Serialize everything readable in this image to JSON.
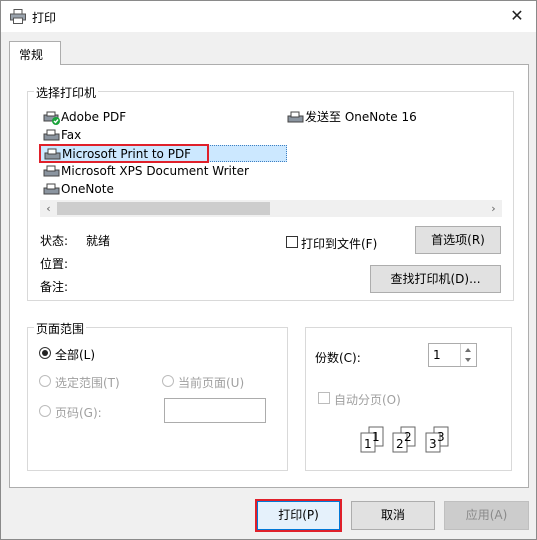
{
  "window": {
    "title": "打印",
    "close_glyph": "✕"
  },
  "tabs": [
    {
      "label": "常规"
    }
  ],
  "printer_group": {
    "label": "选择打印机",
    "printers": [
      {
        "name": "Adobe PDF",
        "icon": "printer-default-icon"
      },
      {
        "name": "Fax",
        "icon": "fax-icon"
      },
      {
        "name": "Microsoft Print to PDF",
        "icon": "printer-icon",
        "selected": true
      },
      {
        "name": "Microsoft XPS Document Writer",
        "icon": "printer-icon"
      },
      {
        "name": "OneNote",
        "icon": "printer-icon"
      },
      {
        "name": "发送至 OneNote 16",
        "icon": "printer-icon"
      }
    ],
    "scroll_left": "‹",
    "scroll_right": "›"
  },
  "status": {
    "status_label": "状态:",
    "status_value": "就绪",
    "location_label": "位置:",
    "comment_label": "备注:",
    "print_to_file": "打印到文件(F)",
    "preferences_button": "首选项(R)",
    "find_printer_button": "查找打印机(D)..."
  },
  "page_range": {
    "label": "页面范围",
    "all": "全部(L)",
    "selection": "选定范围(T)",
    "current_page": "当前页面(U)",
    "pages": "页码(G):",
    "pages_value": ""
  },
  "copies": {
    "label": "份数(C):",
    "value": "1",
    "collate": "自动分页(O)"
  },
  "collate_digits": [
    "1",
    "1",
    "2",
    "2",
    "3",
    "3"
  ],
  "footer": {
    "print": "打印(P)",
    "cancel": "取消",
    "apply": "应用(A)"
  }
}
